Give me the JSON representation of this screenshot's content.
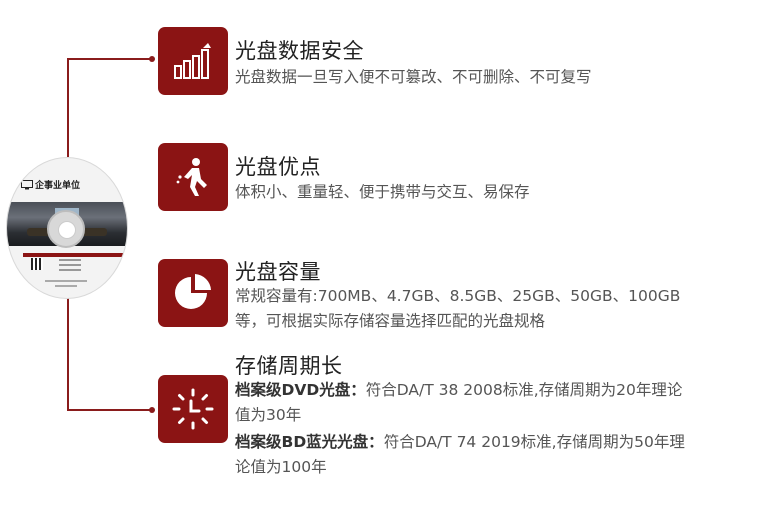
{
  "disc": {
    "org_label": "企事业单位",
    "monitor_icon": "monitor-icon"
  },
  "sections": [
    {
      "icon": "chart-growth-icon",
      "title": "光盘数据安全",
      "desc": "光盘数据一旦写入便不可篡改、不可删除、不可复写"
    },
    {
      "icon": "walking-person-icon",
      "title": "光盘优点",
      "desc": "体积小、重量轻、便于携带与交互、易保存"
    },
    {
      "icon": "pie-chart-icon",
      "title": "光盘容量",
      "desc_line1": "常规容量有:700MB、4.7GB、8.5GB、25GB、50GB、100GB",
      "desc_line2": "等，可根据实际存储容量选择匹配的光盘规格"
    },
    {
      "icon": "clock-icon",
      "title": "存储周期长",
      "items": [
        {
          "label": "档案级DVD光盘：",
          "line1": "符合DA/T 38 2008标准,存储周期为20年理论",
          "line2": "值为30年"
        },
        {
          "label": "档案级BD蓝光光盘：",
          "line1": "符合DA/T 74 2019标准,存储周期为50年理",
          "line2": "论值为100年"
        }
      ]
    }
  ],
  "colors": {
    "accent": "#8b1414",
    "connector": "#8a1c1c",
    "title": "#222222",
    "desc": "#555555"
  }
}
